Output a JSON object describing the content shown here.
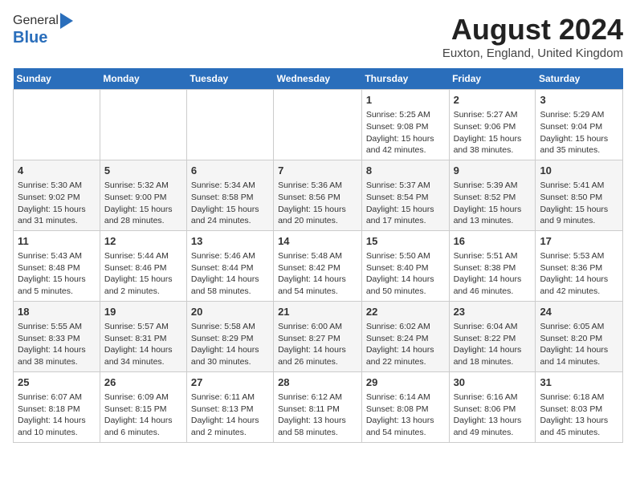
{
  "header": {
    "logo_general": "General",
    "logo_blue": "Blue",
    "month_title": "August 2024",
    "location": "Euxton, England, United Kingdom"
  },
  "weekdays": [
    "Sunday",
    "Monday",
    "Tuesday",
    "Wednesday",
    "Thursday",
    "Friday",
    "Saturday"
  ],
  "weeks": [
    [
      {
        "day": "",
        "info": ""
      },
      {
        "day": "",
        "info": ""
      },
      {
        "day": "",
        "info": ""
      },
      {
        "day": "",
        "info": ""
      },
      {
        "day": "1",
        "info": "Sunrise: 5:25 AM\nSunset: 9:08 PM\nDaylight: 15 hours\nand 42 minutes."
      },
      {
        "day": "2",
        "info": "Sunrise: 5:27 AM\nSunset: 9:06 PM\nDaylight: 15 hours\nand 38 minutes."
      },
      {
        "day": "3",
        "info": "Sunrise: 5:29 AM\nSunset: 9:04 PM\nDaylight: 15 hours\nand 35 minutes."
      }
    ],
    [
      {
        "day": "4",
        "info": "Sunrise: 5:30 AM\nSunset: 9:02 PM\nDaylight: 15 hours\nand 31 minutes."
      },
      {
        "day": "5",
        "info": "Sunrise: 5:32 AM\nSunset: 9:00 PM\nDaylight: 15 hours\nand 28 minutes."
      },
      {
        "day": "6",
        "info": "Sunrise: 5:34 AM\nSunset: 8:58 PM\nDaylight: 15 hours\nand 24 minutes."
      },
      {
        "day": "7",
        "info": "Sunrise: 5:36 AM\nSunset: 8:56 PM\nDaylight: 15 hours\nand 20 minutes."
      },
      {
        "day": "8",
        "info": "Sunrise: 5:37 AM\nSunset: 8:54 PM\nDaylight: 15 hours\nand 17 minutes."
      },
      {
        "day": "9",
        "info": "Sunrise: 5:39 AM\nSunset: 8:52 PM\nDaylight: 15 hours\nand 13 minutes."
      },
      {
        "day": "10",
        "info": "Sunrise: 5:41 AM\nSunset: 8:50 PM\nDaylight: 15 hours\nand 9 minutes."
      }
    ],
    [
      {
        "day": "11",
        "info": "Sunrise: 5:43 AM\nSunset: 8:48 PM\nDaylight: 15 hours\nand 5 minutes."
      },
      {
        "day": "12",
        "info": "Sunrise: 5:44 AM\nSunset: 8:46 PM\nDaylight: 15 hours\nand 2 minutes."
      },
      {
        "day": "13",
        "info": "Sunrise: 5:46 AM\nSunset: 8:44 PM\nDaylight: 14 hours\nand 58 minutes."
      },
      {
        "day": "14",
        "info": "Sunrise: 5:48 AM\nSunset: 8:42 PM\nDaylight: 14 hours\nand 54 minutes."
      },
      {
        "day": "15",
        "info": "Sunrise: 5:50 AM\nSunset: 8:40 PM\nDaylight: 14 hours\nand 50 minutes."
      },
      {
        "day": "16",
        "info": "Sunrise: 5:51 AM\nSunset: 8:38 PM\nDaylight: 14 hours\nand 46 minutes."
      },
      {
        "day": "17",
        "info": "Sunrise: 5:53 AM\nSunset: 8:36 PM\nDaylight: 14 hours\nand 42 minutes."
      }
    ],
    [
      {
        "day": "18",
        "info": "Sunrise: 5:55 AM\nSunset: 8:33 PM\nDaylight: 14 hours\nand 38 minutes."
      },
      {
        "day": "19",
        "info": "Sunrise: 5:57 AM\nSunset: 8:31 PM\nDaylight: 14 hours\nand 34 minutes."
      },
      {
        "day": "20",
        "info": "Sunrise: 5:58 AM\nSunset: 8:29 PM\nDaylight: 14 hours\nand 30 minutes."
      },
      {
        "day": "21",
        "info": "Sunrise: 6:00 AM\nSunset: 8:27 PM\nDaylight: 14 hours\nand 26 minutes."
      },
      {
        "day": "22",
        "info": "Sunrise: 6:02 AM\nSunset: 8:24 PM\nDaylight: 14 hours\nand 22 minutes."
      },
      {
        "day": "23",
        "info": "Sunrise: 6:04 AM\nSunset: 8:22 PM\nDaylight: 14 hours\nand 18 minutes."
      },
      {
        "day": "24",
        "info": "Sunrise: 6:05 AM\nSunset: 8:20 PM\nDaylight: 14 hours\nand 14 minutes."
      }
    ],
    [
      {
        "day": "25",
        "info": "Sunrise: 6:07 AM\nSunset: 8:18 PM\nDaylight: 14 hours\nand 10 minutes."
      },
      {
        "day": "26",
        "info": "Sunrise: 6:09 AM\nSunset: 8:15 PM\nDaylight: 14 hours\nand 6 minutes."
      },
      {
        "day": "27",
        "info": "Sunrise: 6:11 AM\nSunset: 8:13 PM\nDaylight: 14 hours\nand 2 minutes."
      },
      {
        "day": "28",
        "info": "Sunrise: 6:12 AM\nSunset: 8:11 PM\nDaylight: 13 hours\nand 58 minutes."
      },
      {
        "day": "29",
        "info": "Sunrise: 6:14 AM\nSunset: 8:08 PM\nDaylight: 13 hours\nand 54 minutes."
      },
      {
        "day": "30",
        "info": "Sunrise: 6:16 AM\nSunset: 8:06 PM\nDaylight: 13 hours\nand 49 minutes."
      },
      {
        "day": "31",
        "info": "Sunrise: 6:18 AM\nSunset: 8:03 PM\nDaylight: 13 hours\nand 45 minutes."
      }
    ]
  ]
}
